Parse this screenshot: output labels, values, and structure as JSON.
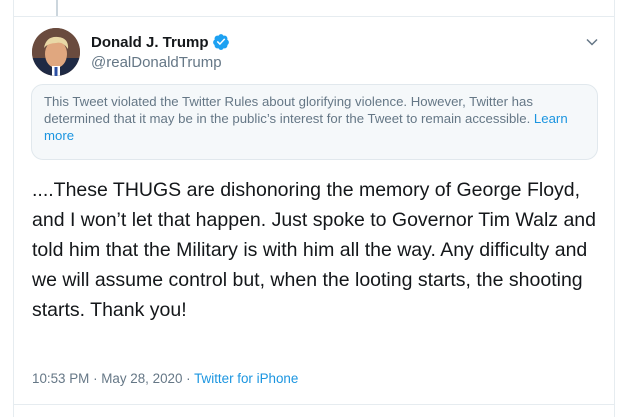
{
  "tweet": {
    "author": {
      "display_name": "Donald J. Trump",
      "handle": "@realDonaldTrump",
      "verified_icon": "verified-badge-icon",
      "avatar_icon": "avatar"
    },
    "menu_icon": "chevron-down-icon",
    "notice": {
      "text": "This Tweet violated the Twitter Rules about glorifying violence. However, Twitter has determined that it may be in the public’s interest for the Tweet to remain accessible.",
      "link_label": "Learn more"
    },
    "text": "....These THUGS are dishonoring the memory of George Floyd, and I won’t let that happen. Just spoke to Governor Tim Walz and told him that the Military is with him all the way. Any difficulty and we will assume control but, when the looting starts, the shooting starts. Thank you!",
    "time": "10:53 PM",
    "separator_1": "·",
    "date": "May 28, 2020",
    "separator_2": "·",
    "source": "Twitter for iPhone"
  },
  "colors": {
    "verified": "#1da1f2",
    "link": "#1b95e0",
    "muted": "#657786"
  }
}
